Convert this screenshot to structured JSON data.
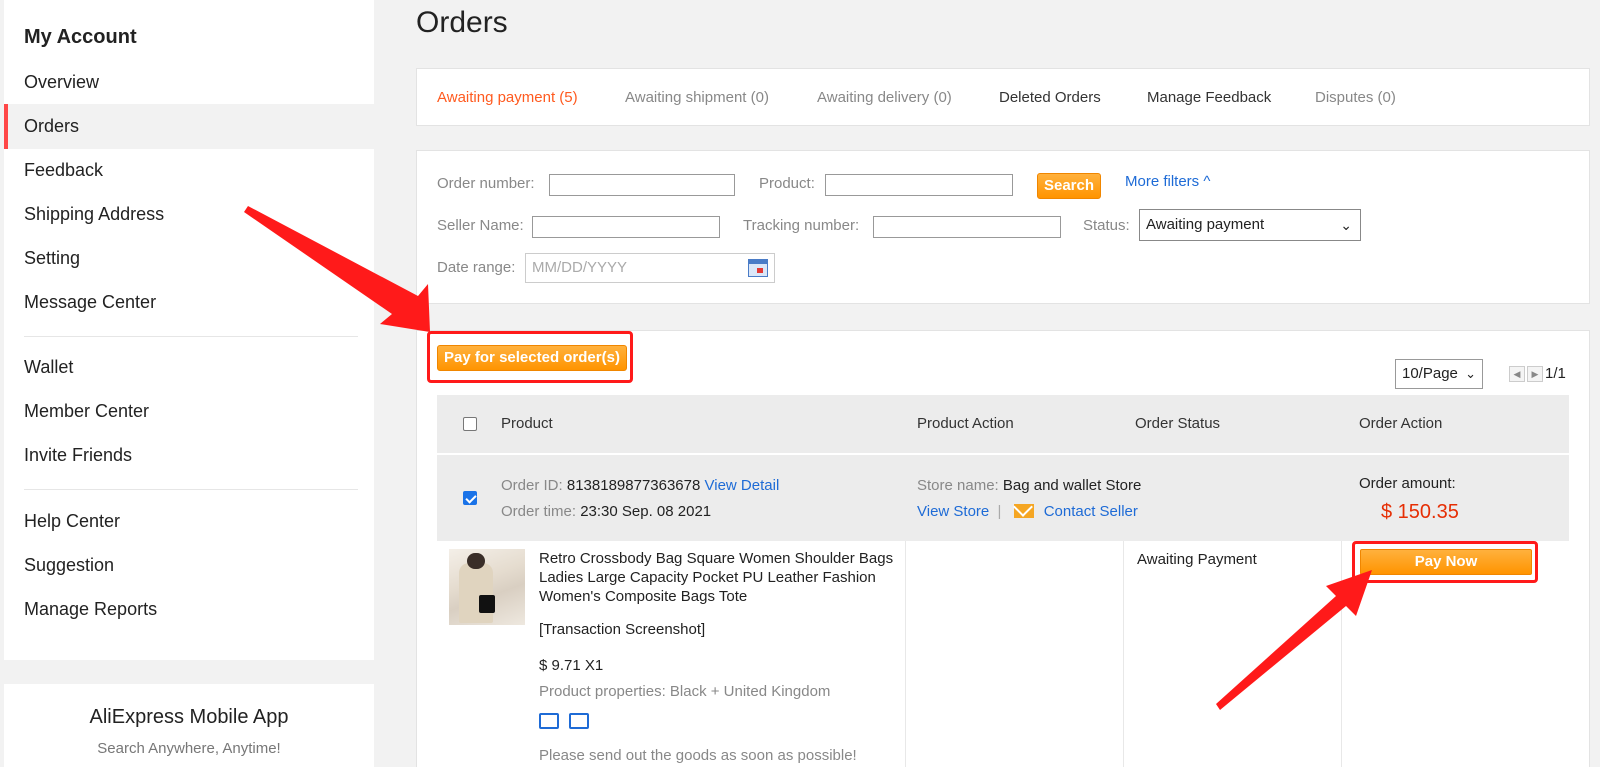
{
  "sidebar": {
    "title": "My Account",
    "items": [
      {
        "label": "Overview"
      },
      {
        "label": "Orders"
      },
      {
        "label": "Feedback"
      },
      {
        "label": "Shipping Address"
      },
      {
        "label": "Setting"
      },
      {
        "label": "Message Center"
      },
      {
        "label": "Wallet"
      },
      {
        "label": "Member Center"
      },
      {
        "label": "Invite Friends"
      },
      {
        "label": "Help Center"
      },
      {
        "label": "Suggestion"
      },
      {
        "label": "Manage Reports"
      }
    ],
    "active_item": "Orders"
  },
  "app_promo": {
    "title": "AliExpress Mobile App",
    "subtitle": "Search Anywhere, Anytime!"
  },
  "page": {
    "title": "Orders"
  },
  "tabs": [
    {
      "label": "Awaiting payment (5)"
    },
    {
      "label": "Awaiting shipment (0)"
    },
    {
      "label": "Awaiting delivery (0)"
    },
    {
      "label": "Deleted Orders"
    },
    {
      "label": "Manage Feedback"
    },
    {
      "label": "Disputes (0)"
    }
  ],
  "filters": {
    "order_number_label": "Order number:",
    "order_number_value": "",
    "product_label": "Product:",
    "product_value": "",
    "search_label": "Search",
    "more_filters_label": "More filters ^",
    "seller_name_label": "Seller Name:",
    "seller_name_value": "",
    "tracking_label": "Tracking number:",
    "tracking_value": "",
    "status_label": "Status:",
    "status_value": "Awaiting payment",
    "date_label": "Date range:",
    "date_placeholder": "MM/DD/YYYY"
  },
  "orders": {
    "pay_selected_label": "Pay for selected order(s)",
    "per_page": "10/Page",
    "page_indicator": "1/1",
    "columns": [
      "Product",
      "Product Action",
      "Order Status",
      "Order Action"
    ],
    "order": {
      "id_label": "Order ID:",
      "id": "8138189877363678",
      "view_detail": "View Detail",
      "time_label": "Order time:",
      "time": "23:30 Sep. 08 2021",
      "store_label": "Store name:",
      "store": "Bag and wallet Store",
      "view_store": "View Store",
      "separator": "|",
      "contact_seller": "Contact Seller",
      "amount_label": "Order amount:",
      "amount": "$ 150.35",
      "product_title": "Retro Crossbody Bag Square Women Shoulder Bags Ladies Large Capacity Pocket PU Leather Fashion Women's Composite Bags Tote",
      "snapshot": "[Transaction Screenshot]",
      "price_qty": "$ 9.71 X1",
      "properties": "Product properties: Black + United Kingdom",
      "note": "Please send out the goods as soon as possible!",
      "status": "Awaiting Payment",
      "pay_now": "Pay Now"
    }
  },
  "colors": {
    "accent_orange": "#ff9400",
    "active_tab": "#ff5a1f",
    "price_red": "#e62e04",
    "link_blue": "#1e6bd6",
    "annotation_red": "#ff1a1a"
  }
}
